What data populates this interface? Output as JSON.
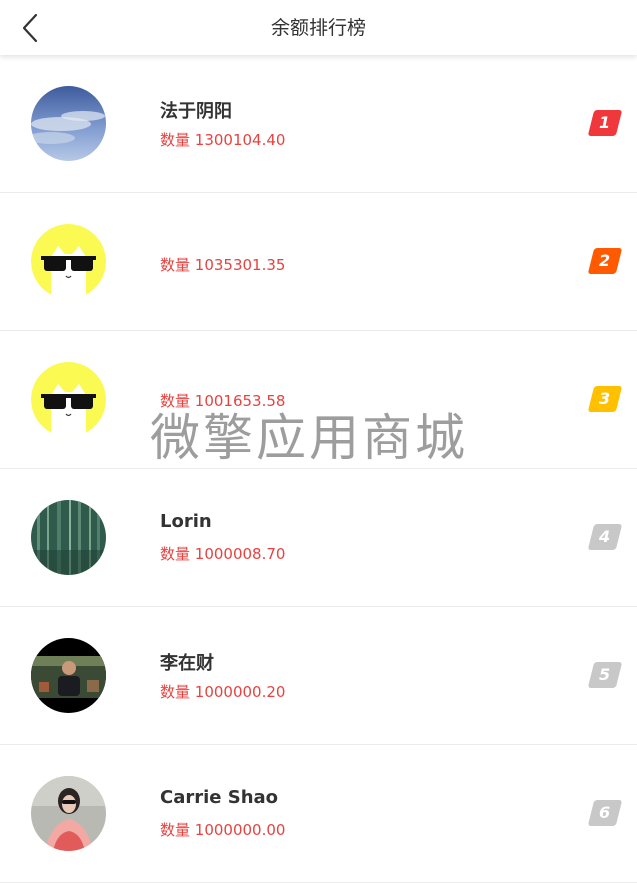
{
  "header": {
    "title": "余额排行榜",
    "back_icon": "chevron-left-icon"
  },
  "qty_prefix": "数量",
  "rows": [
    {
      "name": "法于阴阳",
      "quantity": "1300104.40",
      "rank": "1",
      "rank_color": "#f0383c",
      "avatar": "sky-photo"
    },
    {
      "name": "",
      "quantity": "1035301.35",
      "rank": "2",
      "rank_color": "#ff5a00",
      "avatar": "cat-sunglasses"
    },
    {
      "name": "",
      "quantity": "1001653.58",
      "rank": "3",
      "rank_color": "#ffc000",
      "avatar": "cat-sunglasses"
    },
    {
      "name": "Lorin",
      "quantity": "1000008.70",
      "rank": "4",
      "rank_color": "#c8c8c8",
      "avatar": "bamboo-photo"
    },
    {
      "name": "李在财",
      "quantity": "1000000.20",
      "rank": "5",
      "rank_color": "#c8c8c8",
      "avatar": "person-photo"
    },
    {
      "name": "Carrie Shao",
      "quantity": "1000000.00",
      "rank": "6",
      "rank_color": "#c8c8c8",
      "avatar": "woman-photo"
    }
  ],
  "watermark": "微擎应用商城",
  "colors": {
    "quantity_text": "#e64340",
    "name_text": "#333333",
    "divider": "#ececec"
  }
}
